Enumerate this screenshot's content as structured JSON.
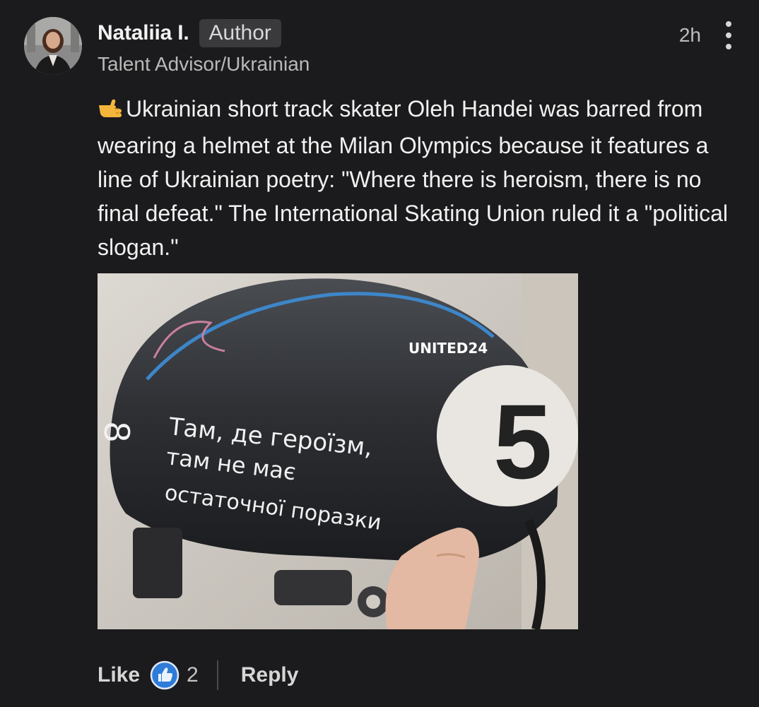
{
  "comment": {
    "author": {
      "name": "Nataliia I.",
      "badge": "Author",
      "headline": "Talent Advisor/Ukrainian"
    },
    "timestamp": "2h",
    "more_icon": "more-vertical-icon",
    "body": {
      "emoji": "👉",
      "text": "Ukrainian short track skater Oleh Handei was barred from wearing a helmet at the Milan Olympics because it features a line of Ukrainian poetry: \"Where there is heroism, there is no final defeat.\" The International Skating Union ruled it a \"political slogan.\""
    },
    "image": {
      "watermark": "UNITED24",
      "helmet_text_line1": "Там, де героїзм,",
      "helmet_text_line2": "там не має",
      "helmet_text_line3": "остаточної поразки",
      "helmet_number": "5",
      "side_logo": "8"
    },
    "actions": {
      "like_label": "Like",
      "reaction_icon": "like-thumb-icon",
      "reaction_count": "2",
      "reply_label": "Reply"
    }
  },
  "colors": {
    "background": "#1b1b1d",
    "reaction_blue": "#2f7bd8",
    "badge_bg": "#3a3a3d"
  }
}
